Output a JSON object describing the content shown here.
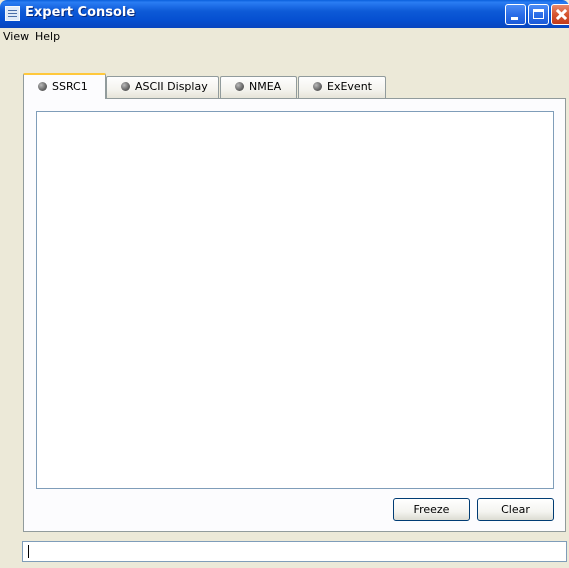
{
  "window": {
    "title": "Expert Console"
  },
  "menu": {
    "items": [
      {
        "label": "View"
      },
      {
        "label": "Help"
      }
    ]
  },
  "tabs": [
    {
      "label": "SSRC1",
      "active": true,
      "status_icon": "gray-status-dot-icon"
    },
    {
      "label": "ASCII Display",
      "active": false,
      "status_icon": "gray-status-dot-icon"
    },
    {
      "label": "NMEA",
      "active": false,
      "status_icon": "gray-status-dot-icon"
    },
    {
      "label": "ExEvent",
      "active": false,
      "status_icon": "gray-status-dot-icon"
    }
  ],
  "console": {
    "output_text": "",
    "freeze_label": "Freeze",
    "clear_label": "Clear"
  },
  "command": {
    "value": ""
  },
  "colors": {
    "titlebar": "#0650d1",
    "window_bg": "#ece9d8",
    "active_tab_accent": "#ffc83c"
  }
}
